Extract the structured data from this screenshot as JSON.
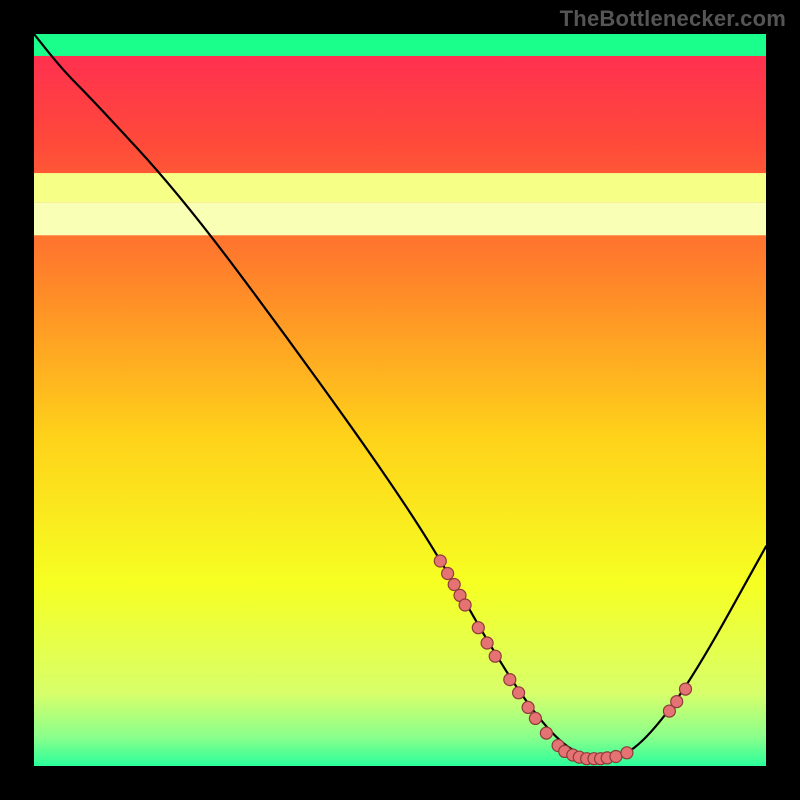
{
  "watermark": "TheBottlenecker.com",
  "chart_data": {
    "type": "line",
    "title": "",
    "xlabel": "",
    "ylabel": "",
    "xlim": [
      0,
      100
    ],
    "ylim": [
      0,
      100
    ],
    "background_gradient": {
      "stops": [
        {
          "pct": 0,
          "color": "#ff2a55"
        },
        {
          "pct": 15,
          "color": "#ff4a3a"
        },
        {
          "pct": 35,
          "color": "#ff8a28"
        },
        {
          "pct": 55,
          "color": "#ffd21a"
        },
        {
          "pct": 75,
          "color": "#f6ff22"
        },
        {
          "pct": 90,
          "color": "#d8ff6a"
        },
        {
          "pct": 96,
          "color": "#8bff8b"
        },
        {
          "pct": 100,
          "color": "#2aff9a"
        }
      ]
    },
    "solid_bands": [
      {
        "y_from": 72.5,
        "y_to": 77,
        "color": "#f9ffb4"
      },
      {
        "y_from": 77,
        "y_to": 81,
        "color": "#f6ff86"
      },
      {
        "y_from": 97,
        "y_to": 100,
        "color": "#1aff8c"
      }
    ],
    "series": [
      {
        "name": "bottleneck-curve",
        "x": [
          0,
          4,
          8,
          20,
          35,
          50,
          58,
          62,
          67,
          72,
          76,
          80,
          84,
          90,
          100
        ],
        "y": [
          100,
          95,
          91,
          78,
          58,
          37,
          24,
          17,
          9,
          3,
          1,
          1,
          4,
          12,
          30
        ]
      }
    ],
    "markers": [
      {
        "x": 55.5,
        "y": 28.0
      },
      {
        "x": 56.5,
        "y": 26.3
      },
      {
        "x": 57.4,
        "y": 24.8
      },
      {
        "x": 58.2,
        "y": 23.3
      },
      {
        "x": 58.9,
        "y": 22.0
      },
      {
        "x": 60.7,
        "y": 18.9
      },
      {
        "x": 61.9,
        "y": 16.8
      },
      {
        "x": 63.0,
        "y": 15.0
      },
      {
        "x": 65.0,
        "y": 11.8
      },
      {
        "x": 66.2,
        "y": 10.0
      },
      {
        "x": 67.5,
        "y": 8.0
      },
      {
        "x": 68.5,
        "y": 6.5
      },
      {
        "x": 70.0,
        "y": 4.5
      },
      {
        "x": 71.6,
        "y": 2.8
      },
      {
        "x": 72.5,
        "y": 2.0
      },
      {
        "x": 73.6,
        "y": 1.5
      },
      {
        "x": 74.5,
        "y": 1.2
      },
      {
        "x": 75.5,
        "y": 1.0
      },
      {
        "x": 76.5,
        "y": 1.0
      },
      {
        "x": 77.4,
        "y": 1.0
      },
      {
        "x": 78.3,
        "y": 1.1
      },
      {
        "x": 79.5,
        "y": 1.3
      },
      {
        "x": 81.0,
        "y": 1.8
      },
      {
        "x": 86.8,
        "y": 7.5
      },
      {
        "x": 87.8,
        "y": 8.8
      },
      {
        "x": 89.0,
        "y": 10.5
      }
    ],
    "marker_style": {
      "color": "#e57373",
      "stroke": "#8e3b3b",
      "radius_px": 6
    }
  }
}
